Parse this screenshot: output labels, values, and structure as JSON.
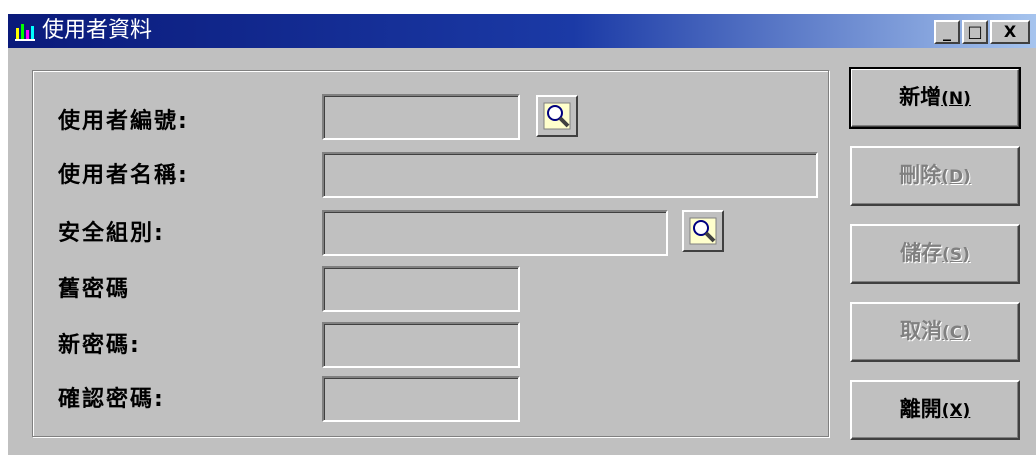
{
  "window": {
    "title": "使用者資料",
    "controls": {
      "minimize": "_",
      "maximize": "□",
      "close": "X"
    }
  },
  "form": {
    "fields": [
      {
        "label": "使用者編號:",
        "value": "",
        "has_lookup": true
      },
      {
        "label": "使用者名稱:",
        "value": "",
        "has_lookup": false
      },
      {
        "label": "安全組別:",
        "value": "",
        "has_lookup": true
      },
      {
        "label": "舊密碼",
        "value": "",
        "has_lookup": false
      },
      {
        "label": "新密碼:",
        "value": "",
        "has_lookup": false
      },
      {
        "label": "確認密碼:",
        "value": "",
        "has_lookup": false
      }
    ]
  },
  "buttons": {
    "add": {
      "label": "新增",
      "hotkey": "(N)",
      "enabled": true
    },
    "delete": {
      "label": "刪除",
      "hotkey": "(D)",
      "enabled": false
    },
    "save": {
      "label": "儲存",
      "hotkey": "(S)",
      "enabled": false
    },
    "cancel": {
      "label": "取消",
      "hotkey": "(C)",
      "enabled": false
    },
    "exit": {
      "label": "離開",
      "hotkey": "(X)",
      "enabled": true
    }
  },
  "icons": {
    "app": "bar-chart-icon",
    "lookup": "magnifier-icon"
  },
  "colors": {
    "titlebar_start": "#0a1a7a",
    "titlebar_end": "#a6c4ee",
    "face": "#c0c0c0"
  }
}
